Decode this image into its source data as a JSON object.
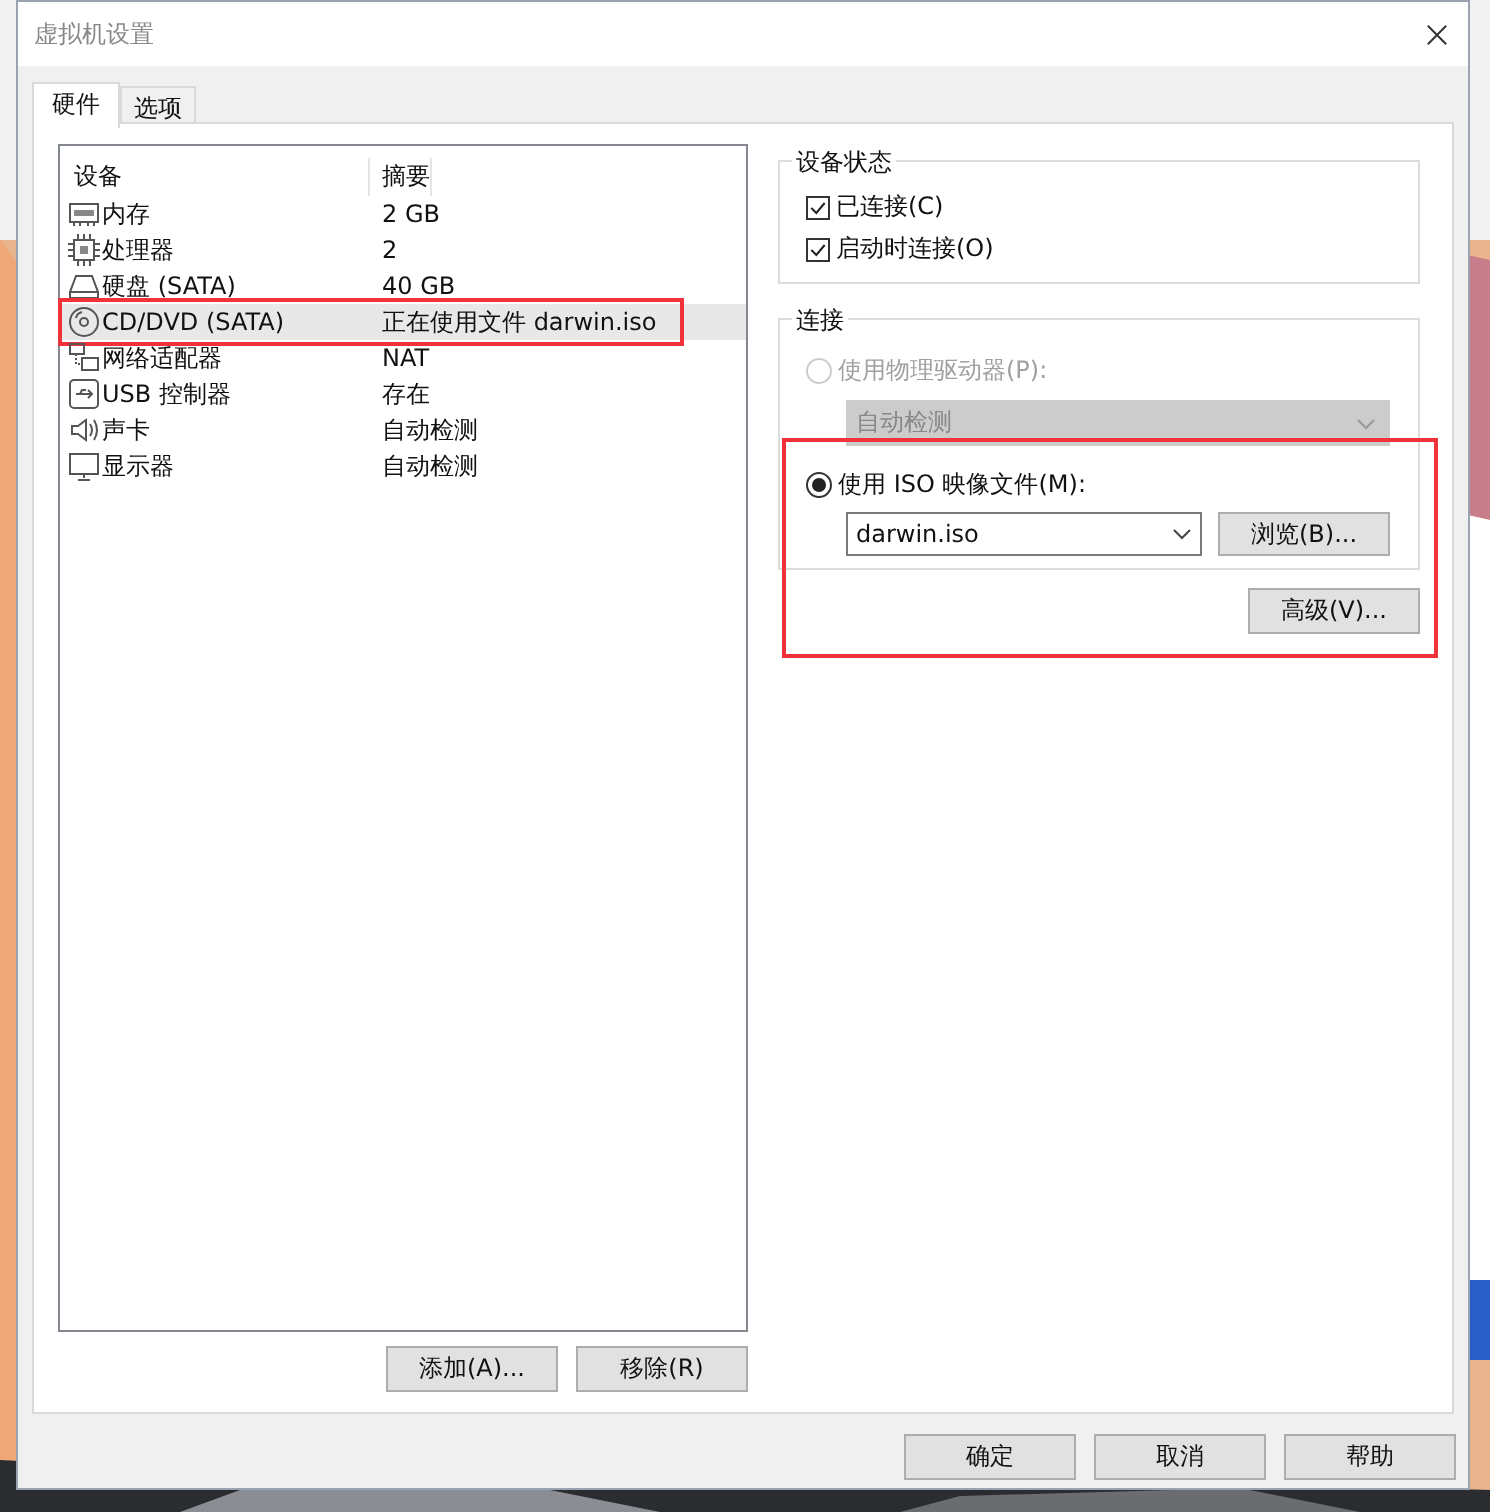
{
  "window": {
    "title": "虚拟机设置"
  },
  "tabs": [
    {
      "label": "硬件",
      "selected": true
    },
    {
      "label": "选项",
      "selected": false
    }
  ],
  "devices": {
    "columns": [
      "设备",
      "摘要"
    ],
    "rows": [
      {
        "kind": "memory",
        "name": "内存",
        "summary": "2 GB",
        "selected": false,
        "highlighted": false
      },
      {
        "kind": "cpu",
        "name": "处理器",
        "summary": "2",
        "selected": false,
        "highlighted": false
      },
      {
        "kind": "disk",
        "name": "硬盘 (SATA)",
        "summary": "40 GB",
        "selected": false,
        "highlighted": false
      },
      {
        "kind": "cd",
        "name": "CD/DVD (SATA)",
        "summary": "正在使用文件 darwin.iso",
        "selected": true,
        "highlighted": true
      },
      {
        "kind": "network",
        "name": "网络适配器",
        "summary": "NAT",
        "selected": false,
        "highlighted": false
      },
      {
        "kind": "usb",
        "name": "USB 控制器",
        "summary": "存在",
        "selected": false,
        "highlighted": false
      },
      {
        "kind": "sound",
        "name": "声卡",
        "summary": "自动检测",
        "selected": false,
        "highlighted": false
      },
      {
        "kind": "display",
        "name": "显示器",
        "summary": "自动检测",
        "selected": false,
        "highlighted": false
      }
    ]
  },
  "list_buttons": [
    "添加(A)...",
    "移除(R)"
  ],
  "device_status": {
    "title": "设备状态",
    "options": [
      {
        "label": "已连接(C)",
        "checked": true
      },
      {
        "label": "启动时连接(O)",
        "checked": true
      }
    ]
  },
  "connection": {
    "title": "连接",
    "physical": {
      "label": "使用物理驱动器(P):",
      "selected": false,
      "disabled": true,
      "drive": "自动检测"
    },
    "iso": {
      "label": "使用 ISO 映像文件(M):",
      "selected": true,
      "file": "darwin.iso",
      "browse": "浏览(B)..."
    },
    "advanced": "高级(V)...",
    "highlighted": true
  },
  "footer_buttons": [
    "确定",
    "取消",
    "帮助"
  ]
}
